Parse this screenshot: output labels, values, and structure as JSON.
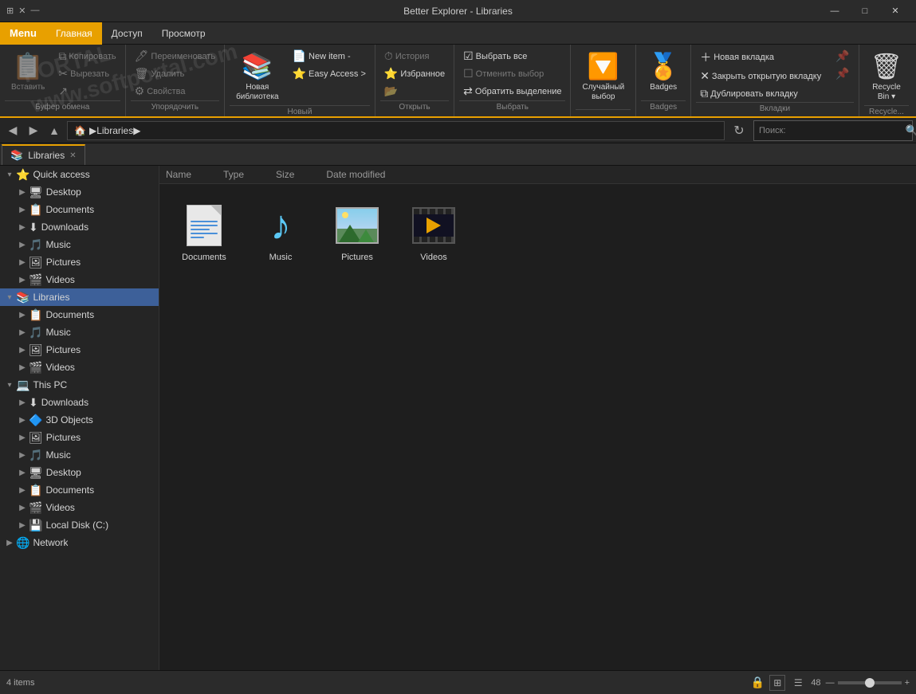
{
  "titleBar": {
    "title": "Better Explorer - Libraries",
    "windowControls": {
      "minimize": "—",
      "maximize": "□",
      "close": "✕"
    }
  },
  "menuBar": {
    "items": [
      "Menu",
      "Главная",
      "Доступ",
      "Просмотр"
    ]
  },
  "ribbon": {
    "groups": [
      {
        "id": "clipboard",
        "label": "Буфер обмена",
        "bigBtns": [],
        "smallBtns": [
          "Копировать",
          "Вставить",
          "Вырезать"
        ]
      },
      {
        "id": "organize",
        "label": "Упорядочить"
      },
      {
        "id": "new",
        "label": "Новый",
        "bigBtn": "Новая библиотека",
        "smallBtns": [
          "New item -",
          "Easy Access >"
        ]
      },
      {
        "id": "open",
        "label": "Открыть",
        "smallBtns": [
          "История",
          "Избранное",
          ""
        ]
      },
      {
        "id": "select",
        "label": "Выбрать",
        "smallBtns": [
          "Выбрать все",
          "Отменить выбор",
          "Обратить выделение"
        ]
      },
      {
        "id": "random",
        "label": "Случайный выбор",
        "bigBtn": "Случайный выбор"
      },
      {
        "id": "badges",
        "label": "Badges",
        "bigBtn": "Badges"
      },
      {
        "id": "tabs",
        "label": "Вкладки",
        "smallBtns": [
          "Новая вкладка",
          "Закрыть открытую вкладку",
          "Дублировать вкладку"
        ]
      },
      {
        "id": "recycle",
        "label": "Recycle...",
        "bigBtn": "Recycle Bin"
      }
    ]
  },
  "breadcrumb": {
    "path": "Libraries",
    "pathFull": "▶ Libraries ▶",
    "searchPlaceholder": "Поиск:"
  },
  "tabs": [
    {
      "label": "Libraries",
      "icon": "📚",
      "active": true
    }
  ],
  "sidebar": {
    "sections": [
      {
        "label": "Quick access",
        "icon": "⭐",
        "expanded": true,
        "items": [
          {
            "label": "Desktop",
            "icon": "🖥",
            "indent": 1
          },
          {
            "label": "Documents",
            "icon": "📋",
            "indent": 1
          },
          {
            "label": "Downloads",
            "icon": "⬇",
            "indent": 1
          },
          {
            "label": "Music",
            "icon": "🎵",
            "indent": 1
          },
          {
            "label": "Pictures",
            "icon": "🖼",
            "indent": 1
          },
          {
            "label": "Videos",
            "icon": "🎬",
            "indent": 1
          }
        ]
      },
      {
        "label": "Libraries",
        "icon": "📚",
        "expanded": true,
        "selected": true,
        "items": [
          {
            "label": "Documents",
            "icon": "📋",
            "indent": 1
          },
          {
            "label": "Music",
            "icon": "🎵",
            "indent": 1
          },
          {
            "label": "Pictures",
            "icon": "🖼",
            "indent": 1
          },
          {
            "label": "Videos",
            "icon": "🎬",
            "indent": 1
          }
        ]
      },
      {
        "label": "This PC",
        "icon": "💻",
        "expanded": true,
        "items": [
          {
            "label": "Downloads",
            "icon": "⬇",
            "indent": 1
          },
          {
            "label": "3D Objects",
            "icon": "🔷",
            "indent": 1
          },
          {
            "label": "Pictures",
            "icon": "🖼",
            "indent": 1
          },
          {
            "label": "Music",
            "icon": "🎵",
            "indent": 1
          },
          {
            "label": "Desktop",
            "icon": "🖥",
            "indent": 1
          },
          {
            "label": "Documents",
            "icon": "📋",
            "indent": 1
          },
          {
            "label": "Videos",
            "icon": "🎬",
            "indent": 1
          },
          {
            "label": "Local Disk (C:)",
            "icon": "💾",
            "indent": 1
          }
        ]
      },
      {
        "label": "Network",
        "icon": "🌐",
        "expanded": false,
        "items": []
      }
    ]
  },
  "contentArea": {
    "columns": [
      "Name",
      "Type",
      "Size",
      "Date modified"
    ],
    "items": [
      {
        "label": "Documents",
        "type": "documents"
      },
      {
        "label": "Music",
        "type": "music"
      },
      {
        "label": "Pictures",
        "type": "pictures"
      },
      {
        "label": "Videos",
        "type": "videos"
      }
    ]
  },
  "statusBar": {
    "itemCount": "4 items",
    "zoomLevel": "48",
    "viewIcons": [
      "⊞",
      "☰"
    ]
  },
  "watermark": {
    "line1": "PORTAL",
    "line2": "www.softportal.com"
  }
}
